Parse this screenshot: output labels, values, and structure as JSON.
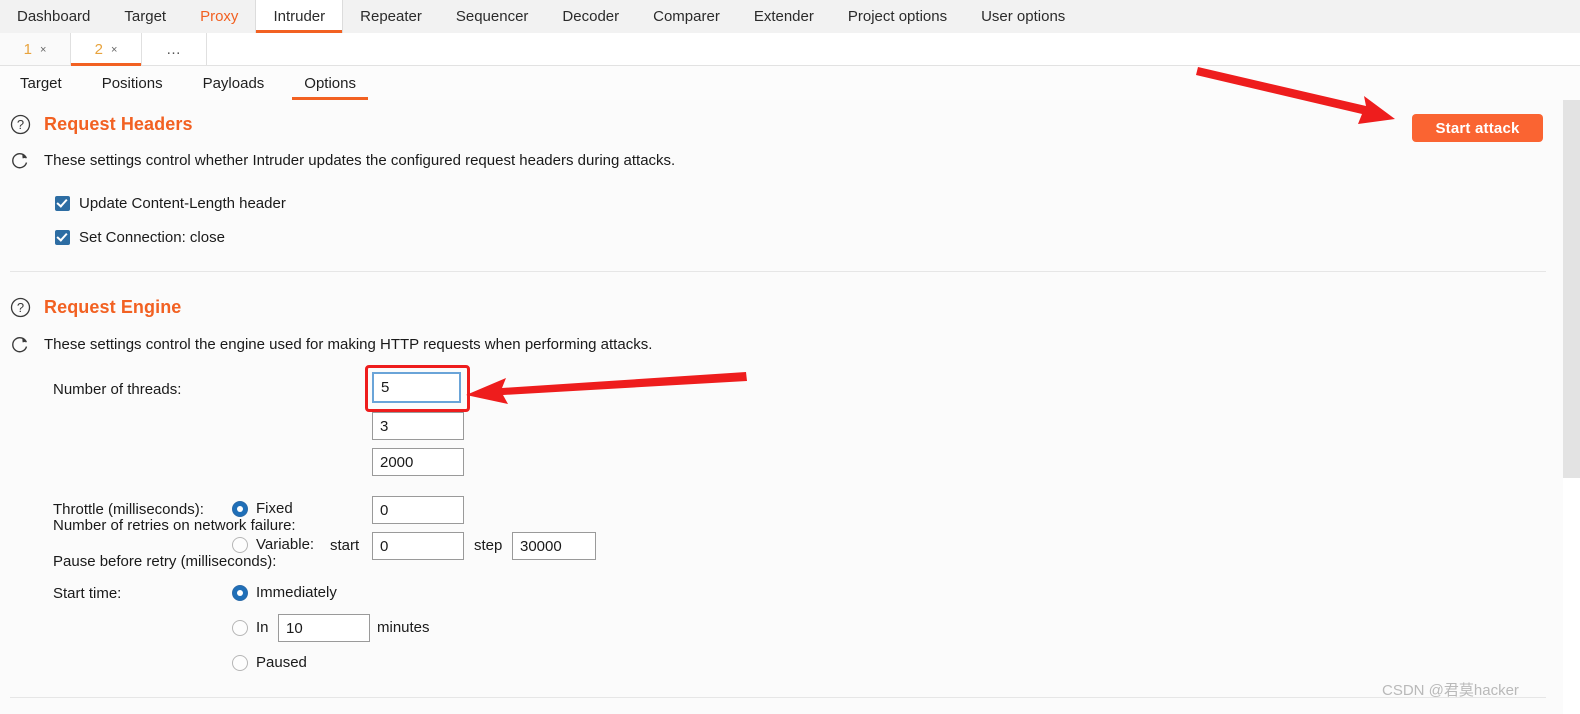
{
  "main_tabs": [
    {
      "label": "Dashboard",
      "state": "normal"
    },
    {
      "label": "Target",
      "state": "normal"
    },
    {
      "label": "Proxy",
      "state": "accent"
    },
    {
      "label": "Intruder",
      "state": "active"
    },
    {
      "label": "Repeater",
      "state": "normal"
    },
    {
      "label": "Sequencer",
      "state": "normal"
    },
    {
      "label": "Decoder",
      "state": "normal"
    },
    {
      "label": "Comparer",
      "state": "normal"
    },
    {
      "label": "Extender",
      "state": "normal"
    },
    {
      "label": "Project options",
      "state": "normal"
    },
    {
      "label": "User options",
      "state": "normal"
    }
  ],
  "attack_tabs": [
    {
      "number": "1",
      "close": "×",
      "active": false
    },
    {
      "number": "2",
      "close": "×",
      "active": true
    }
  ],
  "attack_tabs_more": "…",
  "sub_tabs": [
    {
      "label": "Target",
      "active": false
    },
    {
      "label": "Positions",
      "active": false
    },
    {
      "label": "Payloads",
      "active": false
    },
    {
      "label": "Options",
      "active": true
    }
  ],
  "toolbar": {
    "start_attack_label": "Start attack"
  },
  "request_headers": {
    "title": "Request Headers",
    "description": "These settings control whether Intruder updates the configured request headers during attacks.",
    "help_icon": "question-circle-icon",
    "reset_icon": "refresh-icon",
    "checkboxes": [
      {
        "label": "Update Content-Length header",
        "checked": true
      },
      {
        "label": "Set Connection: close",
        "checked": true
      }
    ]
  },
  "request_engine": {
    "title": "Request Engine",
    "description": "These settings control the engine used for making HTTP requests when performing attacks.",
    "help_icon": "question-circle-icon",
    "reset_icon": "refresh-icon",
    "fields": [
      {
        "label": "Number of threads:",
        "value": "5",
        "focused": true,
        "highlighted": true
      },
      {
        "label": "Number of retries on network failure:",
        "value": "3",
        "focused": false,
        "highlighted": false
      },
      {
        "label": "Pause before retry (milliseconds):",
        "value": "2000",
        "focused": false,
        "highlighted": false
      }
    ],
    "throttle": {
      "label": "Throttle (milliseconds):",
      "fixed": {
        "label": "Fixed",
        "selected": true,
        "value": "0"
      },
      "variable": {
        "label": "Variable:",
        "selected": false,
        "start_label": "start",
        "start_value": "0",
        "step_label": "step",
        "step_value": "30000"
      }
    },
    "start_time": {
      "label": "Start time:",
      "options": [
        {
          "label": "Immediately",
          "selected": true
        },
        {
          "label": "In",
          "selected": false,
          "value": "10",
          "suffix": "minutes"
        },
        {
          "label": "Paused",
          "selected": false
        }
      ]
    }
  },
  "annotations": {
    "arrow_to_start_attack": "red-arrow-pointing-to-start-attack-button",
    "arrow_to_threads": "red-arrow-pointing-to-number-of-threads-field"
  },
  "watermark": {
    "text": "CSDN @君莫hacker"
  },
  "colors": {
    "accent": "#f26122",
    "button": "#fa6432",
    "checkbox": "#2d6da3",
    "radio": "#1f6fb8",
    "annotation": "#ee1d1d",
    "tab_number": "#e8a33d"
  }
}
